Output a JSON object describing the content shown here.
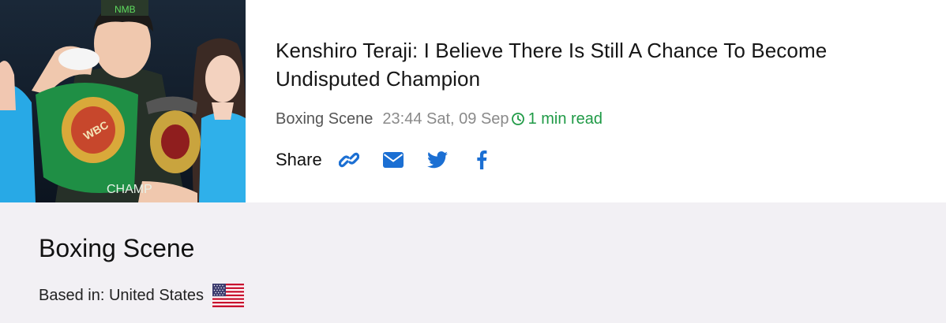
{
  "article": {
    "title": "Kenshiro Teraji: I Believe There Is Still A Chance To Become Undisputed Champion",
    "source": "Boxing Scene",
    "time": "23:44 Sat, 09 Sep",
    "read_time": "1 min read",
    "image_icon": "boxing-champion-photo"
  },
  "share": {
    "label": "Share",
    "buttons": [
      {
        "name": "link",
        "icon": "link-icon"
      },
      {
        "name": "email",
        "icon": "envelope-icon"
      },
      {
        "name": "twitter",
        "icon": "twitter-icon"
      },
      {
        "name": "facebook",
        "icon": "facebook-icon"
      }
    ]
  },
  "publisher": {
    "name": "Boxing Scene",
    "based_in": "Based in: United States",
    "flag_icon": "us-flag-icon"
  },
  "colors": {
    "accent_blue": "#1b6fd3",
    "read_green": "#1f9a46",
    "footer_bg": "#f2f0f4"
  }
}
